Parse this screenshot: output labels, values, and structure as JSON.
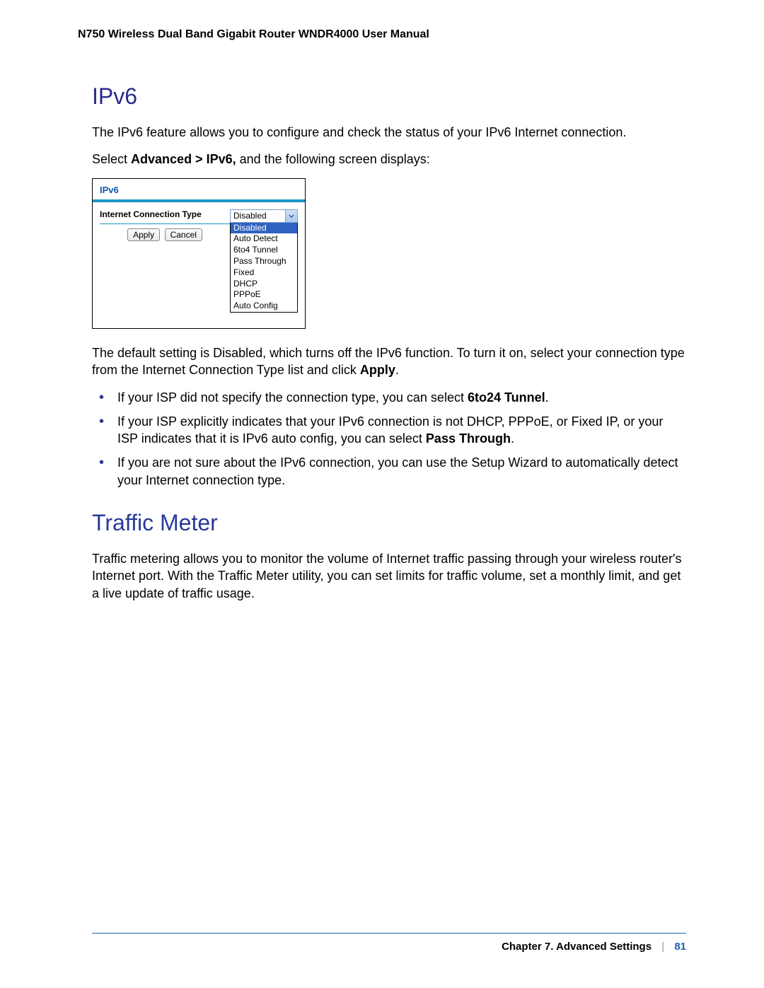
{
  "header": "N750 Wireless Dual Band Gigabit Router WNDR4000 User Manual",
  "section1": {
    "title": "IPv6",
    "p1": "The IPv6 feature allows you to configure and check the status of your IPv6 Internet connection.",
    "p2a": "Select ",
    "p2b": "Advanced > IPv6,",
    "p2c": " and the following screen displays:",
    "p3a": "The default setting is Disabled, which turns off the IPv6 function. To turn it on, select your connection type from the Internet Connection Type list and click ",
    "p3b": "Apply",
    "p3c": ".",
    "bullets": [
      {
        "a": "If your ISP did not specify the connection type, you can select ",
        "b": "6to24 Tunnel",
        "c": "."
      },
      {
        "a": "If your ISP explicitly indicates that your IPv6 connection is not DHCP, PPPoE, or Fixed IP, or your ISP indicates that it is IPv6 auto config, you can select ",
        "b": "Pass Through",
        "c": "."
      },
      {
        "a": "If you are not sure about the IPv6 connection, you can use the Setup Wizard to automatically detect your Internet connection type.",
        "b": "",
        "c": ""
      }
    ]
  },
  "ipv6_screen": {
    "panel_title": "IPv6",
    "label": "Internet Connection Type",
    "apply": "Apply",
    "cancel": "Cancel",
    "selected": "Disabled",
    "options": [
      "Disabled",
      "Auto Detect",
      "6to4 Tunnel",
      "Pass Through",
      "Fixed",
      "DHCP",
      "PPPoE",
      "Auto Config"
    ]
  },
  "section2": {
    "title": "Traffic Meter",
    "p1": "Traffic metering allows you to monitor the volume of Internet traffic passing through your wireless router's Internet port. With the Traffic Meter utility, you can set limits for traffic volume, set a monthly limit, and get a live update of traffic usage."
  },
  "footer": {
    "chapter": "Chapter 7.  Advanced Settings",
    "sep": "|",
    "page": "81"
  }
}
